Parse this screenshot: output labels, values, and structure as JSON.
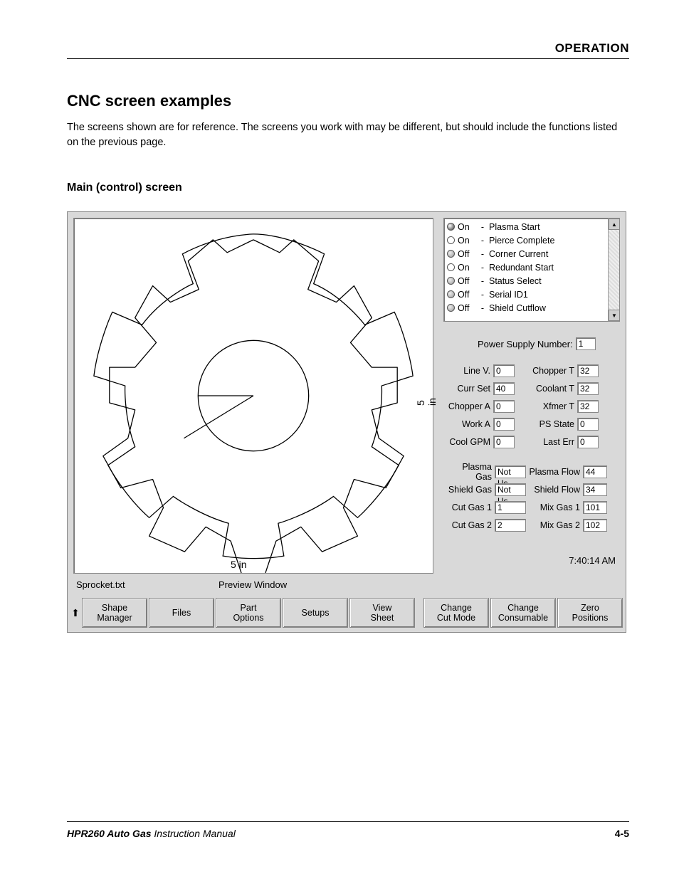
{
  "header": {
    "section": "OPERATION"
  },
  "title": "CNC screen examples",
  "intro": "The screens shown are for reference. The screens you work with may be different, but should include the functions listed on the previous page.",
  "subhead": "Main (control) screen",
  "preview": {
    "x_axis": "5 in",
    "y_axis": "5 in",
    "filename": "Sprocket.txt",
    "label": "Preview Window"
  },
  "status": [
    {
      "led": "on",
      "state": "On",
      "name": "Plasma Start"
    },
    {
      "led": "hollow",
      "state": "On",
      "name": "Pierce Complete"
    },
    {
      "led": "off",
      "state": "Off",
      "name": "Corner Current"
    },
    {
      "led": "hollow",
      "state": "On",
      "name": "Redundant Start"
    },
    {
      "led": "off",
      "state": "Off",
      "name": "Status Select"
    },
    {
      "led": "off",
      "state": "Off",
      "name": "Serial ID1"
    },
    {
      "led": "off",
      "state": "Off",
      "name": "Shield Cutflow"
    }
  ],
  "power_supply": {
    "label": "Power Supply Number:",
    "value": "1"
  },
  "readouts1": [
    {
      "l1": "Line V.",
      "v1": "0",
      "l2": "Chopper T",
      "v2": "32"
    },
    {
      "l1": "Curr Set",
      "v1": "40",
      "l2": "Coolant T",
      "v2": "32"
    },
    {
      "l1": "Chopper A",
      "v1": "0",
      "l2": "Xfmer T",
      "v2": "32"
    },
    {
      "l1": "Work A",
      "v1": "0",
      "l2": "PS State",
      "v2": "0"
    },
    {
      "l1": "Cool GPM",
      "v1": "0",
      "l2": "Last Err",
      "v2": "0"
    }
  ],
  "readouts2": [
    {
      "l1": "Plasma Gas",
      "v1": "Not Us",
      "l2": "Plasma Flow",
      "v2": "44"
    },
    {
      "l1": "Shield Gas",
      "v1": "Not Us",
      "l2": "Shield Flow",
      "v2": "34"
    },
    {
      "l1": "Cut Gas 1",
      "v1": "1",
      "l2": "Mix Gas 1",
      "v2": "101"
    },
    {
      "l1": "Cut Gas 2",
      "v1": "2",
      "l2": "Mix Gas 2",
      "v2": "102"
    }
  ],
  "clock": "7:40:14 AM",
  "buttons": [
    "Shape\nManager",
    "Files",
    "Part\nOptions",
    "Setups",
    "View\nSheet",
    "Change\nCut Mode",
    "Change\nConsumable",
    "Zero\nPositions"
  ],
  "footer": {
    "product": "HPR260 Auto Gas",
    "manual": " Instruction Manual",
    "page": "4-5"
  }
}
